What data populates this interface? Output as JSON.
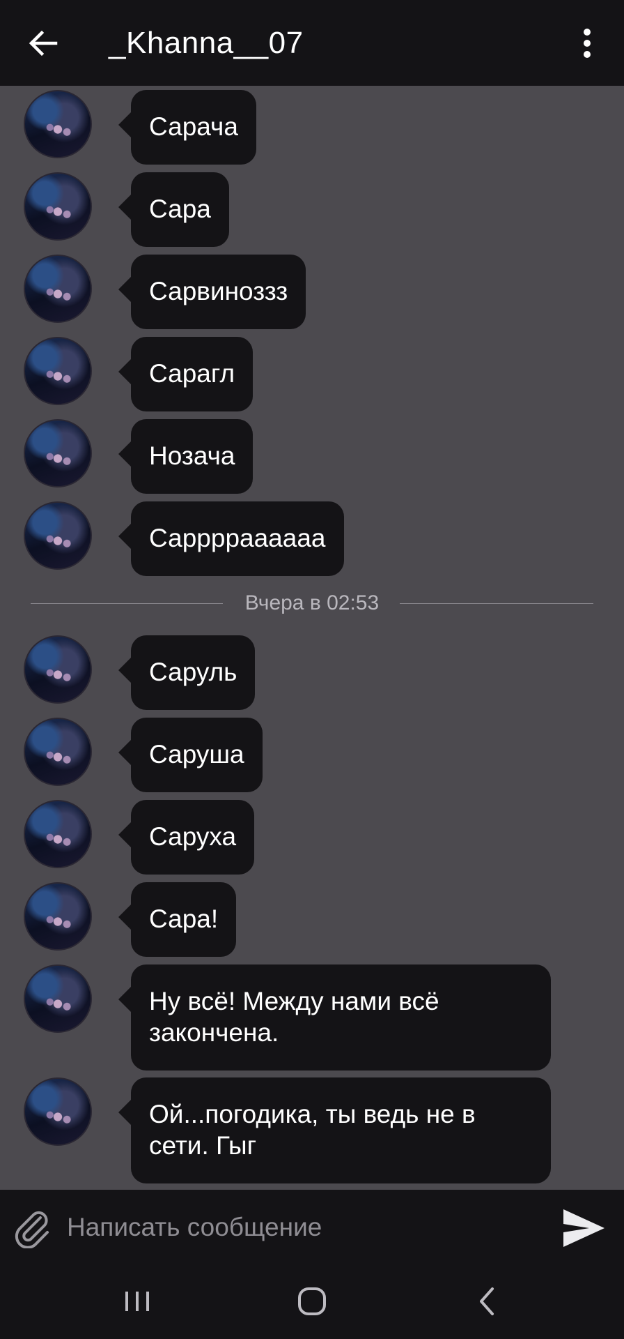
{
  "header": {
    "title": "_Khanna__07",
    "back_icon": "arrow-left-icon",
    "menu_icon": "more-vertical-icon"
  },
  "messages_before": [
    {
      "text": "Сарача"
    },
    {
      "text": "Сара"
    },
    {
      "text": "Сарвиноззз"
    },
    {
      "text": "Сарагл"
    },
    {
      "text": "Нозача"
    },
    {
      "text": "Сарррраааааа"
    }
  ],
  "divider": {
    "timestamp": "Вчера в 02:53"
  },
  "messages_after": [
    {
      "text": "Саруль"
    },
    {
      "text": "Саруша"
    },
    {
      "text": "Саруха"
    },
    {
      "text": "Сара!"
    },
    {
      "text": "Ну всё! Между нами всё закончена."
    },
    {
      "text": "Ой...погодика, ты ведь не в сети. Гыг"
    }
  ],
  "composer": {
    "placeholder": "Написать сообщение",
    "attach_icon": "paperclip-icon",
    "send_icon": "send-icon"
  },
  "system_nav": {
    "recent_icon": "recent-apps-icon",
    "home_icon": "home-icon",
    "back_icon": "back-chevron-icon"
  },
  "colors": {
    "bar_background": "#141316",
    "chat_background": "#4c4a4f",
    "bubble_background": "#141316",
    "text": "#ffffff",
    "placeholder": "#8f8d93"
  }
}
